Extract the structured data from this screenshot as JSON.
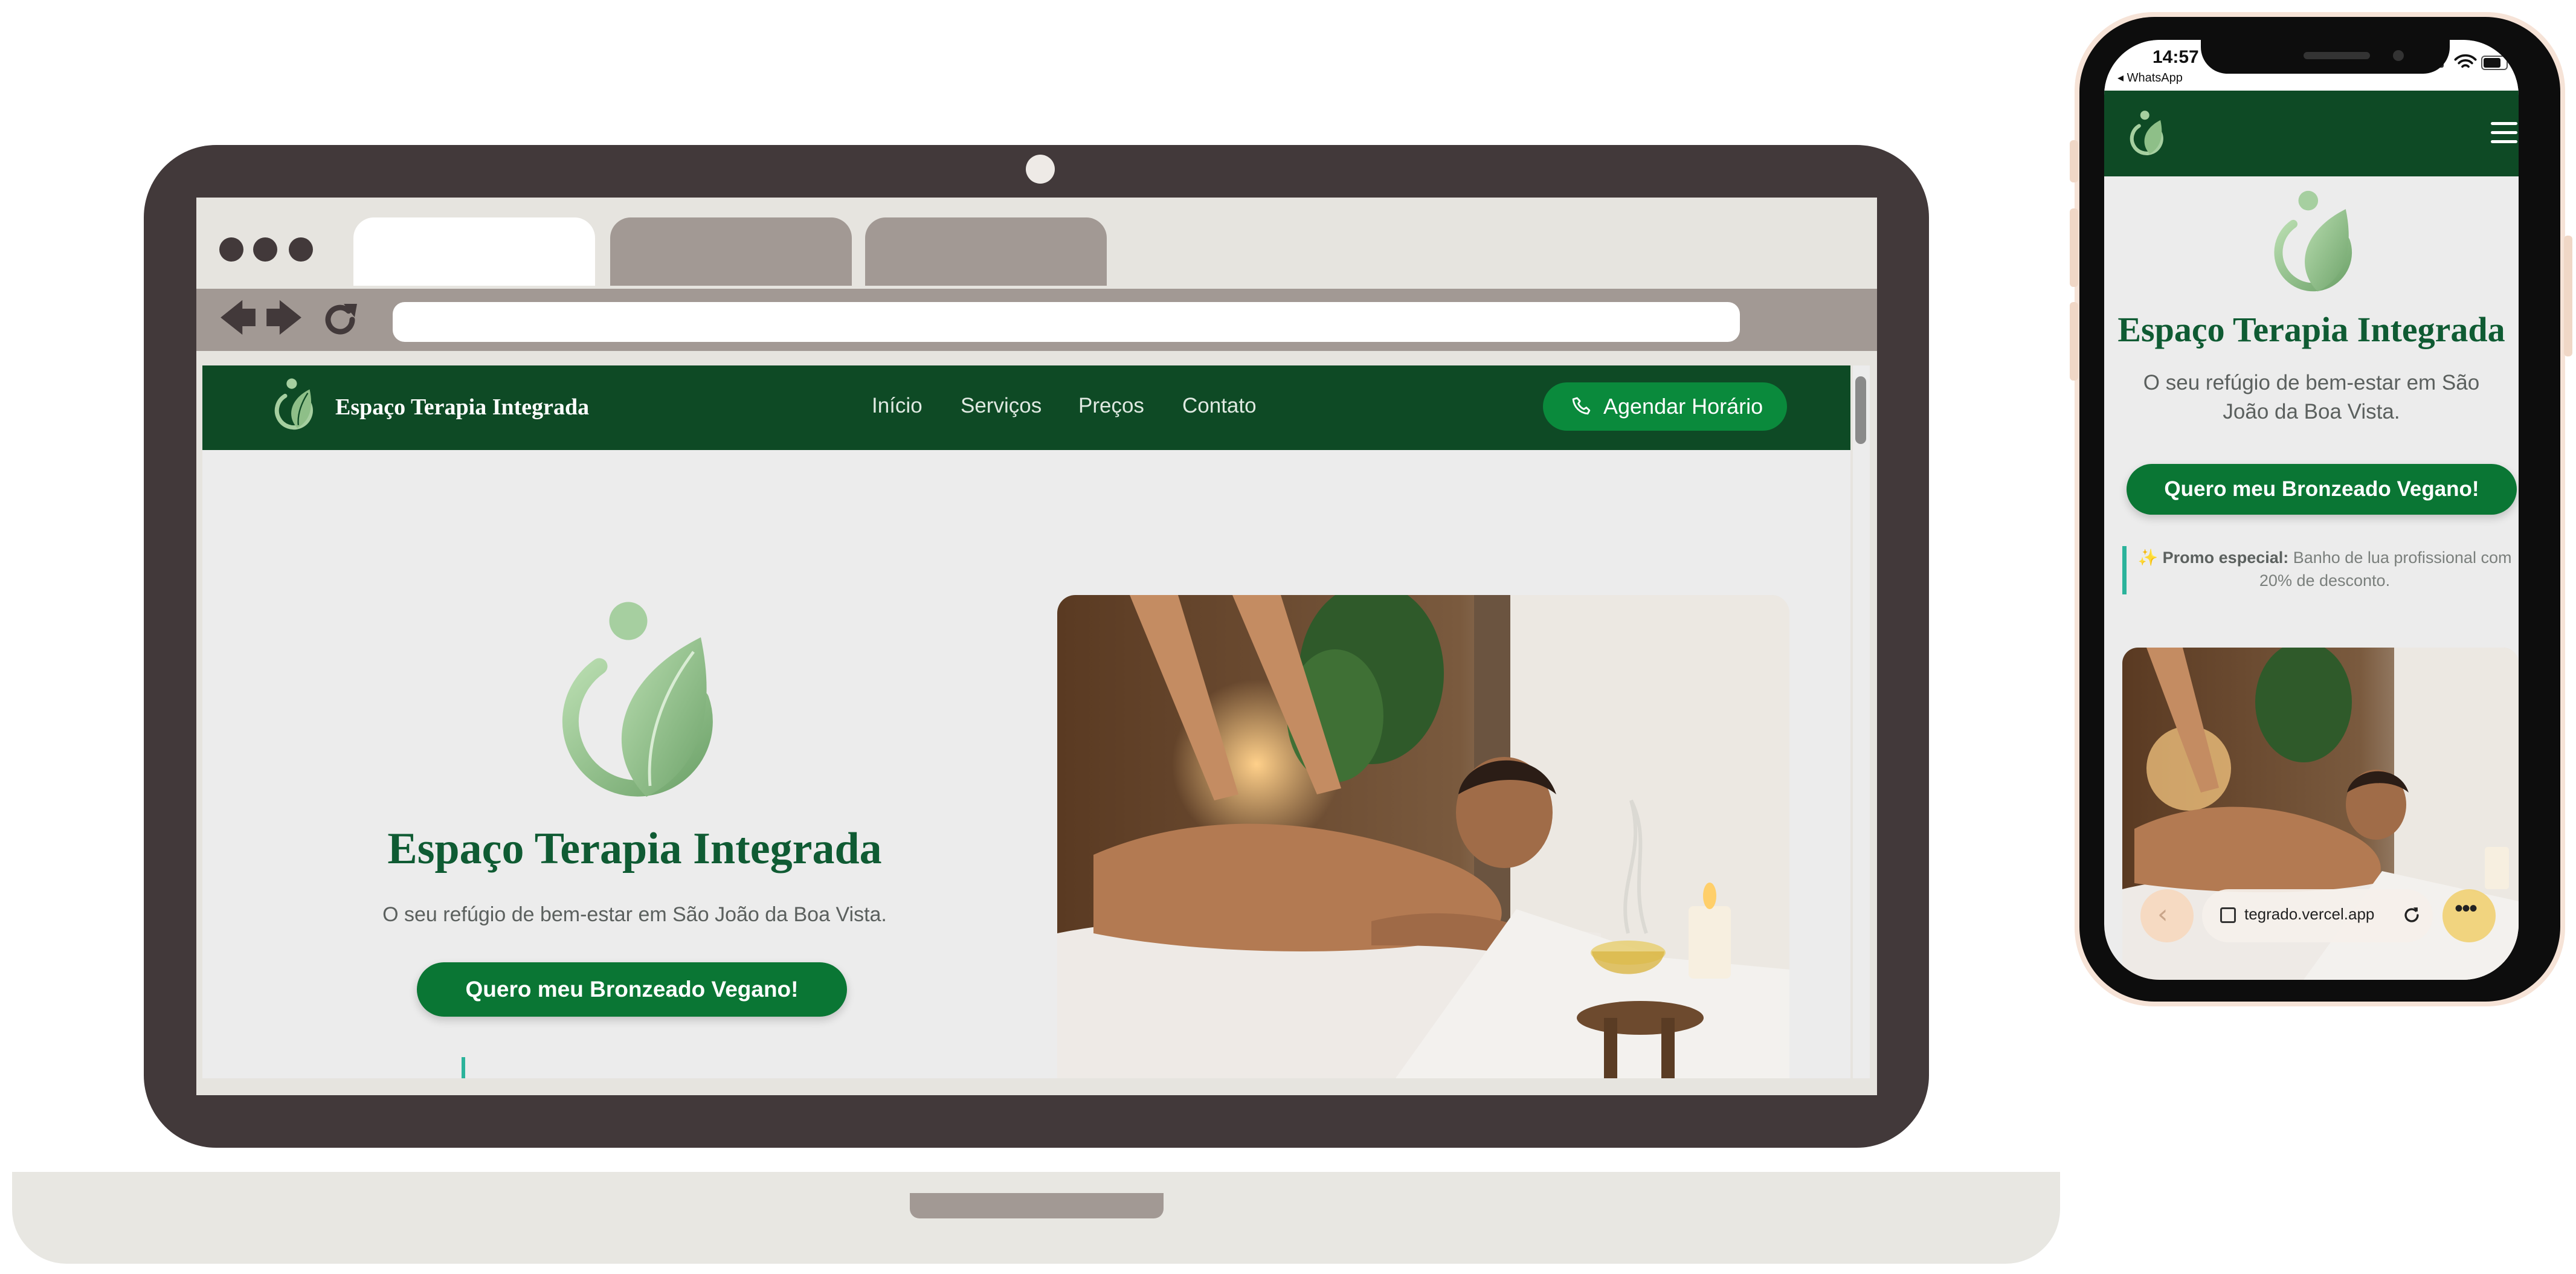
{
  "laptop": {
    "site": {
      "brand": "Espaço Terapia Integrada",
      "nav_links": [
        "Início",
        "Serviços",
        "Preços",
        "Contato"
      ],
      "cta_label": "Agendar Horário",
      "hero": {
        "title": "Espaço Terapia Integrada",
        "subtitle": "O seu refúgio de bem-estar em São João da Boa Vista.",
        "button_label": "Quero meu Bronzeado Vegano!"
      }
    }
  },
  "phone": {
    "status": {
      "time": "14:57",
      "back_app": "◂ WhatsApp"
    },
    "hero": {
      "title": "Espaço Terapia Integrada",
      "subtitle": "O seu refúgio de bem-estar em São João da Boa Vista.",
      "button_label": "Quero meu Bronzeado Vegano!"
    },
    "promo": {
      "icon": "✨",
      "label": "Promo especial:",
      "text": " Banho de lua profissional com 20% de desconto."
    },
    "address_bar": "tegrado.vercel.app"
  },
  "colors": {
    "brand_green": "#0e4a25",
    "cta_green": "#0a8a3c",
    "title_green": "#0f5b33",
    "accent_teal": "#2bb39b",
    "device_frame": "#42393a"
  }
}
